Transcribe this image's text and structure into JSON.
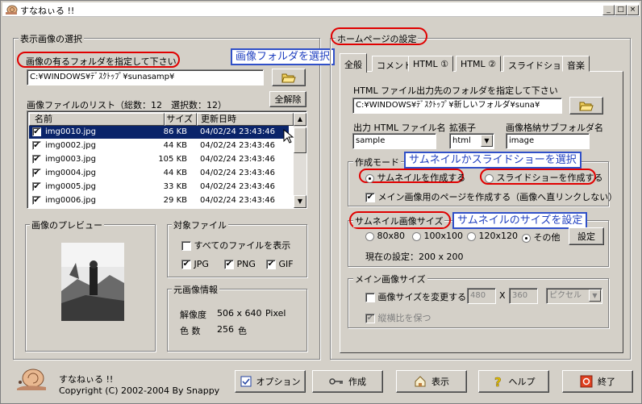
{
  "window": {
    "title": "すなねぃる !!",
    "min": "_",
    "max": "□",
    "close": "×"
  },
  "left": {
    "group_title": "表示画像の選択",
    "folder_label": "画像の有るフォルダを指定して下さい",
    "folder_value": "C:¥WINDOWS¥ﾃﾞｽｸﾄｯﾌﾟ¥sunasamp¥",
    "callout_folder": "画像フォルダを選択",
    "list_title": "画像ファイルのリスト（総数：12　選択数：12）",
    "unselect_all": "全解除",
    "columns": [
      "名前",
      "サイズ",
      "更新日時"
    ],
    "files": [
      {
        "name": "img0010.jpg",
        "size": "86 KB",
        "date": "04/02/24 23:43:46",
        "selected": true
      },
      {
        "name": "img0002.jpg",
        "size": "44 KB",
        "date": "04/02/24 23:43:46",
        "selected": false
      },
      {
        "name": "img0003.jpg",
        "size": "105 KB",
        "date": "04/02/24 23:43:46",
        "selected": false
      },
      {
        "name": "img0004.jpg",
        "size": "44 KB",
        "date": "04/02/24 23:43:46",
        "selected": false
      },
      {
        "name": "img0005.jpg",
        "size": "33 KB",
        "date": "04/02/24 23:43:46",
        "selected": false
      },
      {
        "name": "img0006.jpg",
        "size": "29 KB",
        "date": "04/02/24 23:43:46",
        "selected": false
      }
    ],
    "preview_title": "画像のプレビュー",
    "target_title": "対象ファイル",
    "show_all": "すべてのファイルを表示",
    "jpg": "JPG",
    "png": "PNG",
    "gif": "GIF",
    "info_title": "元画像情報",
    "resolution_label": "解像度",
    "resolution_value": "506 x 640",
    "resolution_unit": "Pixel",
    "colors_label": "色 数",
    "colors_value": "256",
    "colors_unit": "色"
  },
  "right": {
    "group_title": "ホームページの設定",
    "tabs": [
      "全般",
      "コメント",
      "HTML ①",
      "HTML ②",
      "スライドショー",
      "音楽"
    ],
    "out_folder_label": "HTML ファイル出力先のフォルダを指定して下さい",
    "out_folder_value": "C:¥WINDOWS¥ﾃﾞｽｸﾄｯﾌﾟ¥新しいフォルダ¥suna¥",
    "html_name_label": "出力 HTML ファイル名",
    "html_name_value": "sample",
    "ext_label": "拡張子",
    "ext_value": "html",
    "subfolder_label": "画像格納サブフォルダ名",
    "subfolder_value": "image",
    "mode_title": "作成モード",
    "callout_mode": "サムネイルかスライドショーを選択",
    "mode_thumb": "サムネイルを作成する",
    "mode_slide": "スライドショーを作成する",
    "main_page": "メイン画像用のページを作成する（画像へ直リンクしない）",
    "thumb_title": "サムネイル画像サイズ",
    "callout_thumb": "サムネイルのサイズを設定",
    "sizes": [
      "80x80",
      "100x100",
      "120x120",
      "その他"
    ],
    "set_button": "設定",
    "current_setting": "現在の設定：200 x 200",
    "main_size_title": "メイン画像サイズ",
    "change_size": "画像サイズを変更する",
    "width": "480",
    "times": "X",
    "height": "360",
    "unit": "ピクセル",
    "keep_ratio": "縦横比を保つ"
  },
  "footer": {
    "app_name": "すなねぃる !!",
    "copyright": "Copyright (C) 2002-2004 By Snappy",
    "buttons": [
      "オプション",
      "作成",
      "表示",
      "ヘルプ",
      "終了"
    ]
  },
  "colors": {
    "accent": "#0a246a",
    "callout": "#3050c8",
    "highlight": "#e00000"
  }
}
